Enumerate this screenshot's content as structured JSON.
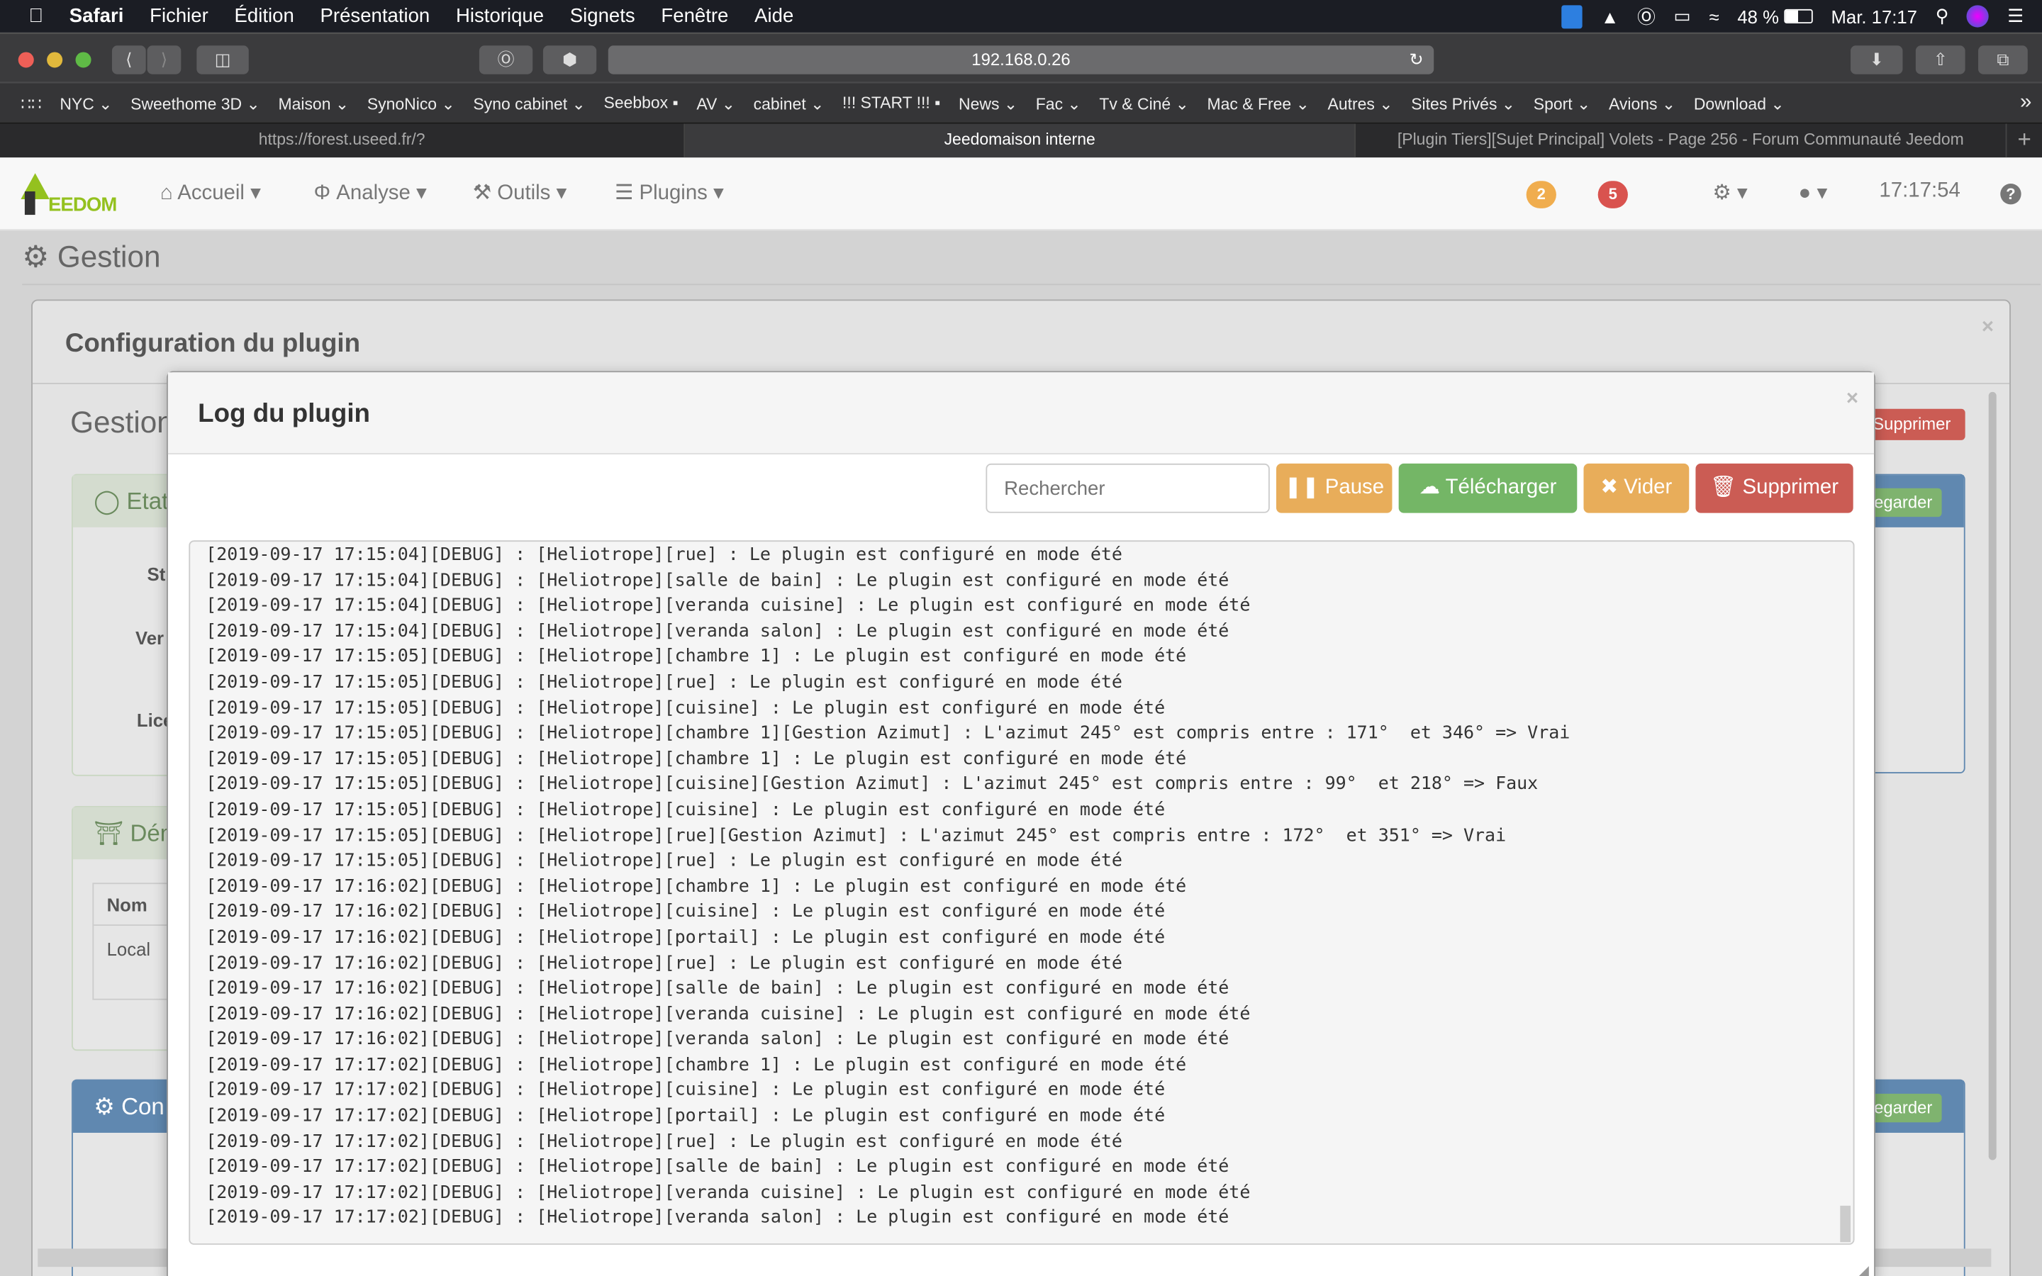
{
  "menubar": {
    "items": [
      "Safari",
      "Fichier",
      "Édition",
      "Présentation",
      "Historique",
      "Signets",
      "Fenêtre",
      "Aide"
    ],
    "battery": "48 %",
    "clock": "Mar. 17:17"
  },
  "browser": {
    "url": "192.168.0.26",
    "bookmarks": [
      "NYC ⌄",
      "Sweethome 3D ⌄",
      "Maison ⌄",
      "SynoNico ⌄",
      "Syno cabinet ⌄",
      "Seebbox ▪",
      "AV ⌄",
      "cabinet ⌄",
      "!!! START !!! ▪",
      "News ⌄",
      "Fac ⌄",
      "Tv & Ciné ⌄",
      "Mac & Free ⌄",
      "Autres ⌄",
      "Sites Privés ⌄",
      "Sport ⌄",
      "Avions ⌄",
      "Download ⌄"
    ],
    "more": "»",
    "tabs": [
      {
        "label": "https://forest.useed.fr/?"
      },
      {
        "label": "Jeedomaison interne",
        "active": true
      },
      {
        "label": "[Plugin Tiers][Sujet Principal] Volets - Page 256 - Forum Communauté Jeedom"
      }
    ],
    "new_tab": "+"
  },
  "jeedom": {
    "logo_text": "EEDOM",
    "nav": [
      "Accueil ▾",
      "Analyse ▾",
      "Outils ▾",
      "Plugins ▾"
    ],
    "badges": [
      {
        "value": "2",
        "color": "#f0ad4e"
      },
      {
        "value": "5",
        "color": "#d9534f"
      }
    ],
    "time": "17:17:54",
    "help": "?"
  },
  "page": {
    "title": "Gestion",
    "config_title": "Configuration du plugin",
    "gestion_partial": "Gestion",
    "etat": "Etat",
    "labels": [
      "St",
      "Ver",
      "Lice"
    ],
    "dem": "Dém",
    "table_head": "Nom",
    "table_cell": "Local",
    "con": "Con",
    "supprimer_partial": "Supprimer",
    "regarder_partial": "egarder"
  },
  "modal": {
    "title": "Log du plugin",
    "search_placeholder": "Rechercher",
    "buttons": {
      "pause": "Pause",
      "download": "Télécharger",
      "clear": "Vider",
      "delete": "Supprimer"
    },
    "colors": {
      "warning": "#e8ad5a",
      "success": "#74b666",
      "danger": "#cb5c54"
    },
    "log": [
      "[2019-09-17 17:15:04][DEBUG] : [Heliotrope][rue] : Le plugin est configuré en mode été",
      "[2019-09-17 17:15:04][DEBUG] : [Heliotrope][salle de bain] : Le plugin est configuré en mode été",
      "[2019-09-17 17:15:04][DEBUG] : [Heliotrope][veranda cuisine] : Le plugin est configuré en mode été",
      "[2019-09-17 17:15:04][DEBUG] : [Heliotrope][veranda salon] : Le plugin est configuré en mode été",
      "[2019-09-17 17:15:05][DEBUG] : [Heliotrope][chambre 1] : Le plugin est configuré en mode été",
      "[2019-09-17 17:15:05][DEBUG] : [Heliotrope][rue] : Le plugin est configuré en mode été",
      "[2019-09-17 17:15:05][DEBUG] : [Heliotrope][cuisine] : Le plugin est configuré en mode été",
      "[2019-09-17 17:15:05][DEBUG] : [Heliotrope][chambre 1][Gestion Azimut] : L'azimut 245° est compris entre : 171°  et 346° => Vrai",
      "[2019-09-17 17:15:05][DEBUG] : [Heliotrope][chambre 1] : Le plugin est configuré en mode été",
      "[2019-09-17 17:15:05][DEBUG] : [Heliotrope][cuisine][Gestion Azimut] : L'azimut 245° est compris entre : 99°  et 218° => Faux",
      "[2019-09-17 17:15:05][DEBUG] : [Heliotrope][cuisine] : Le plugin est configuré en mode été",
      "[2019-09-17 17:15:05][DEBUG] : [Heliotrope][rue][Gestion Azimut] : L'azimut 245° est compris entre : 172°  et 351° => Vrai",
      "[2019-09-17 17:15:05][DEBUG] : [Heliotrope][rue] : Le plugin est configuré en mode été",
      "[2019-09-17 17:16:02][DEBUG] : [Heliotrope][chambre 1] : Le plugin est configuré en mode été",
      "[2019-09-17 17:16:02][DEBUG] : [Heliotrope][cuisine] : Le plugin est configuré en mode été",
      "[2019-09-17 17:16:02][DEBUG] : [Heliotrope][portail] : Le plugin est configuré en mode été",
      "[2019-09-17 17:16:02][DEBUG] : [Heliotrope][rue] : Le plugin est configuré en mode été",
      "[2019-09-17 17:16:02][DEBUG] : [Heliotrope][salle de bain] : Le plugin est configuré en mode été",
      "[2019-09-17 17:16:02][DEBUG] : [Heliotrope][veranda cuisine] : Le plugin est configuré en mode été",
      "[2019-09-17 17:16:02][DEBUG] : [Heliotrope][veranda salon] : Le plugin est configuré en mode été",
      "[2019-09-17 17:17:02][DEBUG] : [Heliotrope][chambre 1] : Le plugin est configuré en mode été",
      "[2019-09-17 17:17:02][DEBUG] : [Heliotrope][cuisine] : Le plugin est configuré en mode été",
      "[2019-09-17 17:17:02][DEBUG] : [Heliotrope][portail] : Le plugin est configuré en mode été",
      "[2019-09-17 17:17:02][DEBUG] : [Heliotrope][rue] : Le plugin est configuré en mode été",
      "[2019-09-17 17:17:02][DEBUG] : [Heliotrope][salle de bain] : Le plugin est configuré en mode été",
      "[2019-09-17 17:17:02][DEBUG] : [Heliotrope][veranda cuisine] : Le plugin est configuré en mode été",
      "[2019-09-17 17:17:02][DEBUG] : [Heliotrope][veranda salon] : Le plugin est configuré en mode été"
    ]
  }
}
